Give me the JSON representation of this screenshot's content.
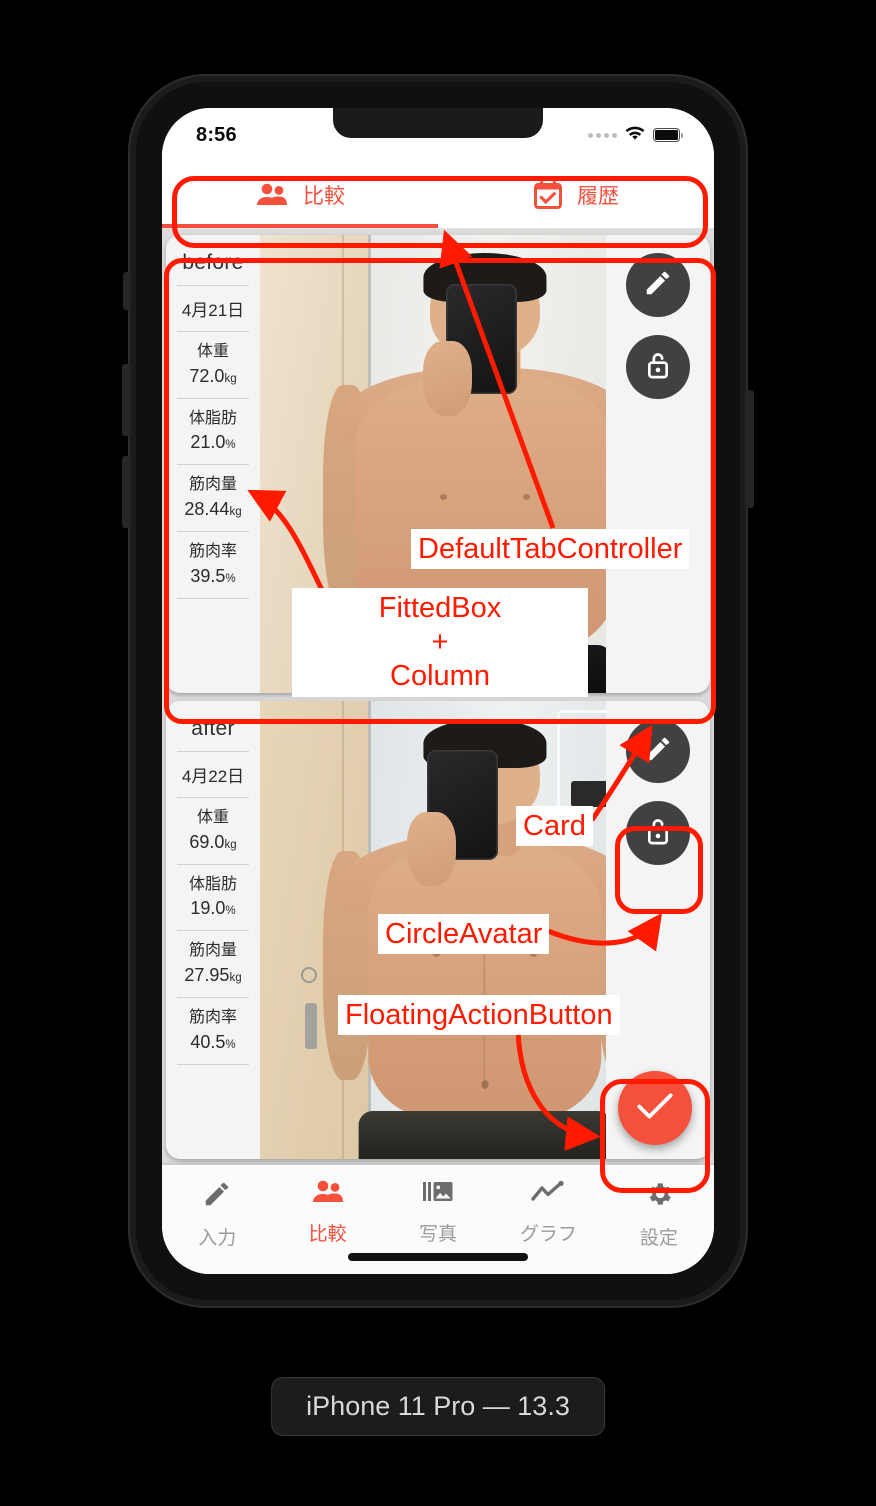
{
  "device": {
    "label": "iPhone 11 Pro — 13.3"
  },
  "statusbar": {
    "time": "8:56",
    "signal_icon": "signal-dots-icon",
    "wifi_icon": "wifi-icon",
    "battery_icon": "battery-icon"
  },
  "top_tabs": {
    "active_index": 0,
    "items": [
      {
        "label": "比較",
        "icon": "people-icon"
      },
      {
        "label": "履歴",
        "icon": "calendar-check-icon"
      }
    ]
  },
  "cards": [
    {
      "title": "before",
      "date": "4月21日",
      "stats": [
        {
          "label": "体重",
          "value": "72.0",
          "unit": "kg"
        },
        {
          "label": "体脂肪",
          "value": "21.0",
          "unit": "%"
        },
        {
          "label": "筋肉量",
          "value": "28.44",
          "unit": "kg"
        },
        {
          "label": "筋肉率",
          "value": "39.5",
          "unit": "%"
        }
      ],
      "actions": [
        {
          "icon": "pencil-icon",
          "name": "edit-button"
        },
        {
          "icon": "unlock-icon",
          "name": "lock-toggle-button"
        }
      ]
    },
    {
      "title": "after",
      "date": "4月22日",
      "stats": [
        {
          "label": "体重",
          "value": "69.0",
          "unit": "kg"
        },
        {
          "label": "体脂肪",
          "value": "19.0",
          "unit": "%"
        },
        {
          "label": "筋肉量",
          "value": "27.95",
          "unit": "kg"
        },
        {
          "label": "筋肉率",
          "value": "40.5",
          "unit": "%"
        }
      ],
      "actions": [
        {
          "icon": "pencil-icon",
          "name": "edit-button"
        },
        {
          "icon": "unlock-icon",
          "name": "lock-toggle-button"
        }
      ],
      "fab": {
        "icon": "check-icon",
        "name": "confirm-fab"
      }
    }
  ],
  "bottom_nav": {
    "active_index": 1,
    "items": [
      {
        "label": "入力",
        "icon": "pencil-icon"
      },
      {
        "label": "比較",
        "icon": "people-icon"
      },
      {
        "label": "写真",
        "icon": "photo-library-icon"
      },
      {
        "label": "グラフ",
        "icon": "line-chart-icon"
      },
      {
        "label": "設定",
        "icon": "gear-icon"
      }
    ]
  },
  "annotations": [
    {
      "text": "DefaultTabController",
      "points_to": "top-tab-bar"
    },
    {
      "text": "FittedBox\n+\nColumn",
      "points_to": "stats-column"
    },
    {
      "text": "Card",
      "points_to": "before-card"
    },
    {
      "text": "CircleAvatar",
      "points_to": "lock-toggle-button"
    },
    {
      "text": "FloatingActionButton",
      "points_to": "confirm-fab"
    }
  ],
  "colors": {
    "accent": "#F4503C",
    "annotation_red": "#FF1A00",
    "avatar_dark": "#414141",
    "inactive_gray": "#9b9b9b"
  }
}
